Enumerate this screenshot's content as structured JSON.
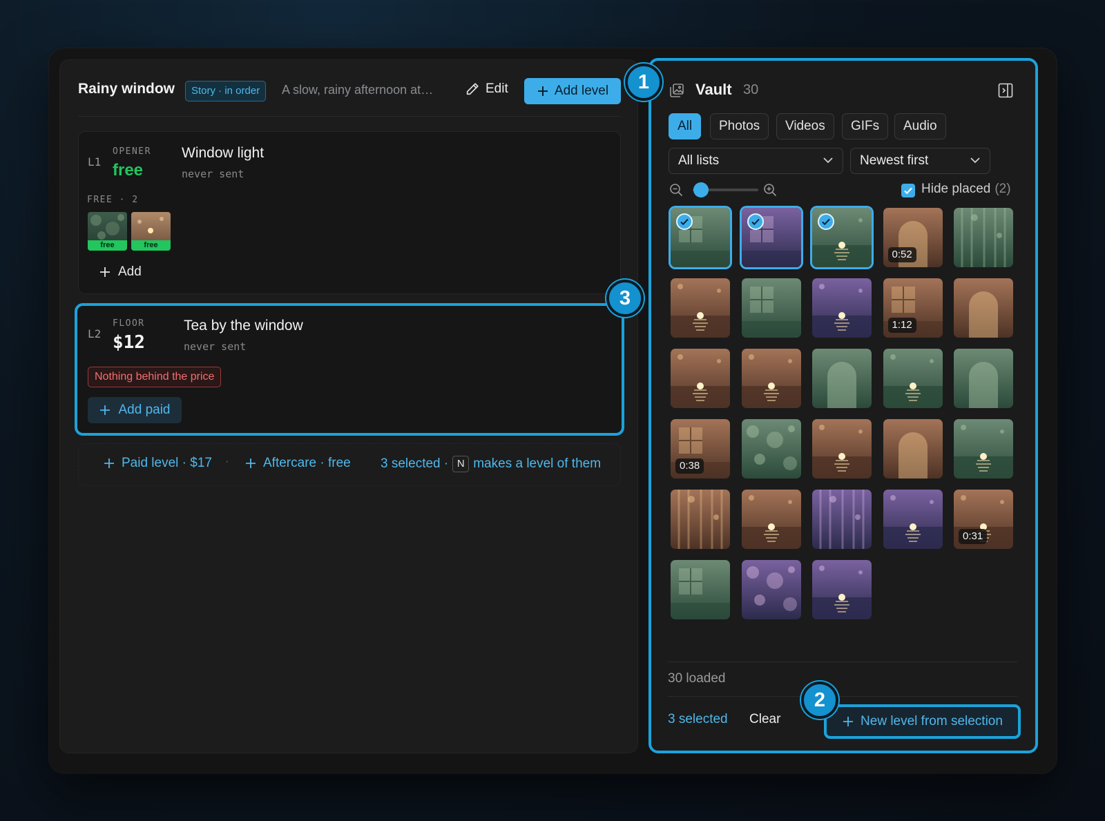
{
  "header": {
    "title": "Rainy window",
    "badge": "Story · in order",
    "description": "A slow, rainy afternoon at…",
    "edit_label": "Edit",
    "add_level_label": "Add level"
  },
  "levels": [
    {
      "code": "L1",
      "kicker": "OPENER",
      "price": "free",
      "name": "Window light",
      "status": "never sent",
      "free_count_label": "FREE · 2",
      "media_tags": [
        "free",
        "free"
      ],
      "add_label": "Add"
    },
    {
      "code": "L2",
      "kicker": "FLOOR",
      "price": "$12",
      "name": "Tea by the window",
      "status": "never sent",
      "warning": "Nothing behind the price",
      "add_paid_label": "Add paid"
    }
  ],
  "quick_actions": {
    "paid_level": "Paid level · $17",
    "aftercare": "Aftercare · free",
    "selected_hint": "3 selected ·",
    "key": "N",
    "hint_tail": "makes a level of them"
  },
  "callouts": [
    "1",
    "2",
    "3"
  ],
  "vault": {
    "title": "Vault",
    "count": "30",
    "filters": [
      "All",
      "Photos",
      "Videos",
      "GIFs",
      "Audio"
    ],
    "active_filter": "All",
    "list_select": "All lists",
    "sort_select": "Newest first",
    "hide_placed_label": "Hide placed",
    "hide_placed_count": "(2)",
    "hide_placed_checked": true,
    "zoom_level": 0.1,
    "thumbs": [
      {
        "palette": "green",
        "motif": "window",
        "selected": true,
        "duration": ""
      },
      {
        "palette": "purple",
        "motif": "window",
        "selected": true,
        "duration": ""
      },
      {
        "palette": "green",
        "motif": "sun",
        "selected": true,
        "duration": ""
      },
      {
        "palette": "amber",
        "motif": "arch",
        "selected": false,
        "duration": "0:52"
      },
      {
        "palette": "green",
        "motif": "rain",
        "selected": false,
        "duration": ""
      },
      {
        "palette": "amber",
        "motif": "sun",
        "selected": false,
        "duration": ""
      },
      {
        "palette": "green",
        "motif": "window",
        "selected": false,
        "duration": ""
      },
      {
        "palette": "purple",
        "motif": "sun",
        "selected": false,
        "duration": ""
      },
      {
        "palette": "amber",
        "motif": "window",
        "selected": false,
        "duration": "1:12"
      },
      {
        "palette": "amber",
        "motif": "arch",
        "selected": false,
        "duration": ""
      },
      {
        "palette": "amber",
        "motif": "sun",
        "selected": false,
        "duration": ""
      },
      {
        "palette": "amber",
        "motif": "sun",
        "selected": false,
        "duration": ""
      },
      {
        "palette": "green",
        "motif": "arch",
        "selected": false,
        "duration": ""
      },
      {
        "palette": "green",
        "motif": "sun",
        "selected": false,
        "duration": ""
      },
      {
        "palette": "green",
        "motif": "arch",
        "selected": false,
        "duration": ""
      },
      {
        "palette": "amber",
        "motif": "window",
        "selected": false,
        "duration": "0:38"
      },
      {
        "palette": "green",
        "motif": "bokeh",
        "selected": false,
        "duration": ""
      },
      {
        "palette": "amber",
        "motif": "sun",
        "selected": false,
        "duration": ""
      },
      {
        "palette": "amber",
        "motif": "arch",
        "selected": false,
        "duration": ""
      },
      {
        "palette": "green",
        "motif": "sun",
        "selected": false,
        "duration": ""
      },
      {
        "palette": "amber",
        "motif": "rain",
        "selected": false,
        "duration": ""
      },
      {
        "palette": "amber",
        "motif": "sun",
        "selected": false,
        "duration": ""
      },
      {
        "palette": "purple",
        "motif": "rain",
        "selected": false,
        "duration": ""
      },
      {
        "palette": "purple",
        "motif": "sun",
        "selected": false,
        "duration": ""
      },
      {
        "palette": "amber",
        "motif": "sun",
        "selected": false,
        "duration": "0:31"
      },
      {
        "palette": "green",
        "motif": "window",
        "selected": false,
        "duration": ""
      },
      {
        "palette": "purple",
        "motif": "bokeh",
        "selected": false,
        "duration": ""
      },
      {
        "palette": "purple",
        "motif": "sun",
        "selected": false,
        "duration": ""
      }
    ],
    "loaded_label": "30 loaded",
    "selected_label": "3 selected",
    "clear_label": "Clear",
    "new_level_label": "New level from selection"
  },
  "colors": {
    "accent": "#3dadea",
    "free": "#22c55e",
    "warning": "#f07070"
  }
}
